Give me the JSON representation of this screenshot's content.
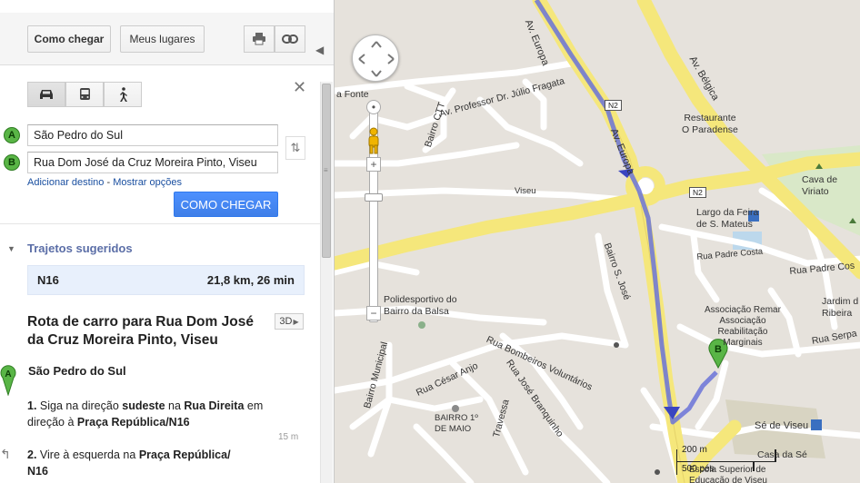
{
  "toolbar": {
    "directions_label": "Como chegar",
    "my_places_label": "Meus lugares"
  },
  "icons": {
    "print": "printer-icon",
    "link": "link-icon",
    "car": "car-icon",
    "transit": "bus-icon",
    "walk": "walking-icon",
    "close": "close-icon",
    "swap": "swap-icon"
  },
  "directions": {
    "marker_a": "A",
    "marker_b": "B",
    "origin_value": "São Pedro do Sul",
    "destination_value": "Rua Dom José da Cruz Moreira Pinto, Viseu",
    "add_destination": "Adicionar destino",
    "separator": "-",
    "show_options": "Mostrar opções",
    "go_button": "COMO CHEGAR"
  },
  "suggested": {
    "heading": "Trajetos sugeridos",
    "route_name": "N16",
    "route_summary": "21,8 km, 26 min"
  },
  "route_detail": {
    "title": "Rota de carro para Rua Dom José da Cruz Moreira Pinto, Viseu",
    "btn_3d": "3D",
    "start_name": "São Pedro do Sul",
    "step1_num": "1.",
    "step1_a": "Siga na direção",
    "step1_b": "sudeste",
    "step1_c": "na",
    "step1_d": "Rua Direita",
    "step1_e": "em direção à",
    "step1_f": "Praça República/N16",
    "step1_dist": "15 m",
    "step2_num": "2.",
    "step2_a": "Vire à esquerda na",
    "step2_b": "Praça República/",
    "step2_c": "N16"
  },
  "map": {
    "colors": {
      "background": "#e6e2dc",
      "major_road": "#f5e77b",
      "minor_road": "#ffffff",
      "route": "#6a73d8",
      "park": "#d4e6c0",
      "marker": "#59b546"
    },
    "labels": {
      "av_europa_1": "Av. Europa",
      "av_europa_2": "Av. Europa",
      "av_julio": "Av. Professor Dr. Júlio Fragata",
      "av_belgica": "Av. Bélgica",
      "fonte": "a Fonte",
      "bairro_ctt": "Bairro CTT",
      "restaurante": "Restaurante\nO Paradense",
      "viseu": "Viseu",
      "largo": "Largo da Feira\nde S. Mateus",
      "cava": "Cava de\nViriato",
      "bairro_s_jose": "Bairro S. José",
      "rua_padre_costa": "Rua Padre Costa",
      "rua_padre_cos": "Rua Padre Cos",
      "jardim": "Jardim d\nRibeira",
      "polidesportivo": "Polidesportivo do\nBairro da Balsa",
      "associacao": "Associação Remar\nAssociação\nReabilitação\nMarginais",
      "rua_serpa": "Rua Serpa",
      "bairro_municipal": "Bairro Municipal",
      "rua_cesar_anjo": "Rua César Anjo",
      "rua_bombeiros": "Rua Bombeiros Voluntários",
      "rua_jose_branquinho": "Rua José Branquinho",
      "travessa": "Travessa",
      "bairro_1_maio": "BAIRRO 1º\nDE MAIO",
      "se_de_viseu": "Sé de Viseu",
      "casa_da_se": "Casa da Sé",
      "escola": "Escola Superior de\nEducação de Viseu"
    },
    "shields": {
      "n2_a": "N2",
      "n2_b": "N2"
    },
    "dest_marker": "B",
    "scale_metric": "200 m",
    "scale_imperial": "500 pés"
  }
}
